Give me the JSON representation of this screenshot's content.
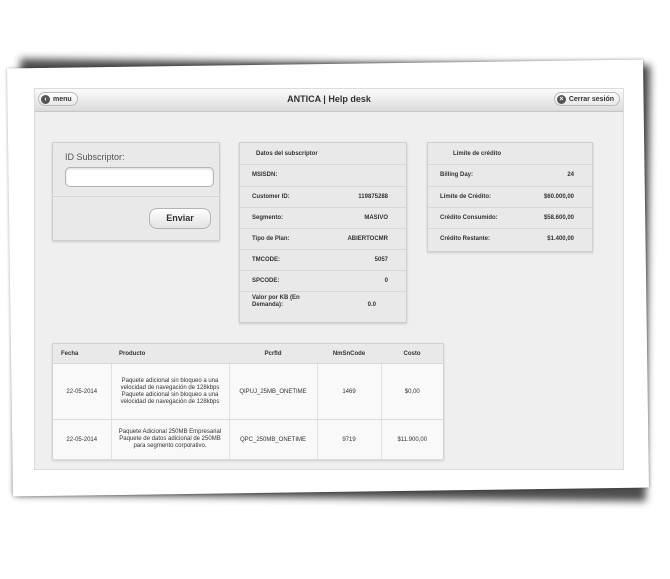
{
  "header": {
    "title": "ANTICA | Help desk",
    "menu_label": "menu",
    "logout_label": "Cerrar sesión"
  },
  "subscriber_form": {
    "label": "ID Subscriptor:",
    "input_value": "",
    "submit_label": "Enviar"
  },
  "subscriber_data": {
    "title": "Datos del subscriptor",
    "rows": [
      {
        "label": "MSISDN:",
        "value": ""
      },
      {
        "label": "Customer ID:",
        "value": "119875288"
      },
      {
        "label": "Segmento:",
        "value": "MASIVO"
      },
      {
        "label": "Tipo de Plan:",
        "value": "ABIERTOCMR"
      },
      {
        "label": "TMCODE:",
        "value": "5057"
      },
      {
        "label": "SPCODE:",
        "value": "0"
      },
      {
        "label": "Valor por KB (En Demanda):",
        "value": "0.0"
      }
    ]
  },
  "credit_limit": {
    "title": "Limite de crédito",
    "rows": [
      {
        "label": "Billing Day:",
        "value": "24"
      },
      {
        "label": "Limite de Crédito:",
        "value": "$60.000,00"
      },
      {
        "label": "Crédito Consumido:",
        "value": "$58.600,00"
      },
      {
        "label": "Crédito Restante:",
        "value": "$1.400,00"
      }
    ]
  },
  "transactions": {
    "columns": [
      "Fecha",
      "Producto",
      "Pcrfld",
      "NmSnCode",
      "Costo"
    ],
    "rows": [
      {
        "fecha": "22-05-2014",
        "producto": "Paquete adicional sin bloqueo a una velocidad de navegación de 128kbps\nPaquete adicional sin bloqueo a una velocidad de navegación de 128kbps",
        "pcrfld": "QIPUJ_25MB_ONETIME",
        "nmsncode": "1469",
        "costo": "$0,00"
      },
      {
        "fecha": "22-05-2014",
        "producto": "Paquete Adicional 250MB Empresarial\nPaquete de datos adicional de 250MB para segmento corporativo.",
        "pcrfld": "QPC_250MB_ONETIME",
        "nmsncode": "9719",
        "costo": "$11.900,00"
      }
    ]
  }
}
